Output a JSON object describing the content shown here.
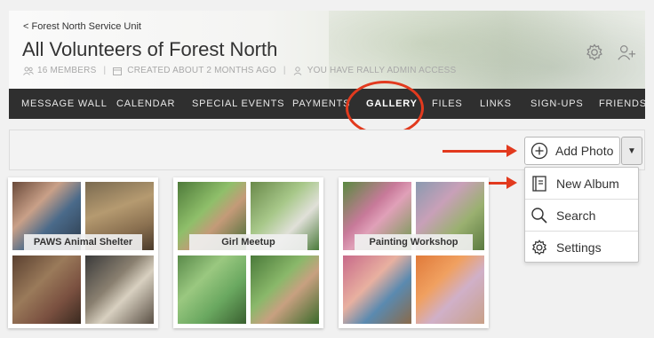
{
  "header": {
    "back_link": "< Forest North Service Unit",
    "title": "All Volunteers of Forest North",
    "meta": {
      "members": "16 MEMBERS",
      "created": "CREATED ABOUT 2 MONTHS AGO",
      "access": "YOU HAVE RALLY ADMIN ACCESS"
    },
    "icons": [
      "gear-icon",
      "add-user-icon"
    ]
  },
  "nav": {
    "items": [
      {
        "label": "MESSAGE WALL"
      },
      {
        "label": "CALENDAR"
      },
      {
        "label": "SPECIAL EVENTS"
      },
      {
        "label": "PAYMENTS"
      },
      {
        "label": "GALLERY",
        "active": true
      },
      {
        "label": "FILES"
      },
      {
        "label": "LINKS"
      },
      {
        "label": "SIGN-UPS"
      },
      {
        "label": "FRIENDS"
      }
    ]
  },
  "actions": {
    "add_photo_label": "Add Photo",
    "dropdown_items": [
      {
        "label": "New Album",
        "icon": "album-icon"
      },
      {
        "label": "Search",
        "icon": "search-icon"
      },
      {
        "label": "Settings",
        "icon": "gear-icon"
      }
    ]
  },
  "albums": [
    {
      "title": "PAWS Animal Shelter"
    },
    {
      "title": "Girl Meetup"
    },
    {
      "title": "Painting Workshop"
    }
  ],
  "colors": {
    "nav_bg": "#2f2f2f",
    "annotation_red": "#e23a1e"
  }
}
